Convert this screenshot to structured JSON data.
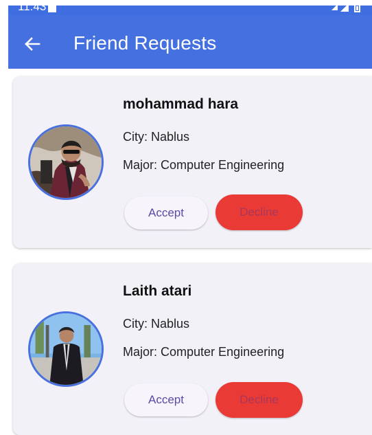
{
  "status_bar": {
    "time": "11:43"
  },
  "header": {
    "back_icon": "arrow-left-icon",
    "title": "Friend Requests"
  },
  "requests": [
    {
      "name": "mohammad hara",
      "city": "City: Nablus",
      "major": "Major: Computer Engineering",
      "accept_label": "Accept",
      "decline_label": "Decline"
    },
    {
      "name": "Laith atari",
      "city": "City: Nablus",
      "major": "Major: Computer Engineering",
      "accept_label": "Accept",
      "decline_label": "Decline"
    }
  ],
  "colors": {
    "app_bar": "#4470e0",
    "card_background": "#f3f1f8",
    "avatar_border": "#4870df",
    "accept_text": "#5d47a8",
    "decline_background": "#ea3a36",
    "decline_text": "#a8375b"
  }
}
